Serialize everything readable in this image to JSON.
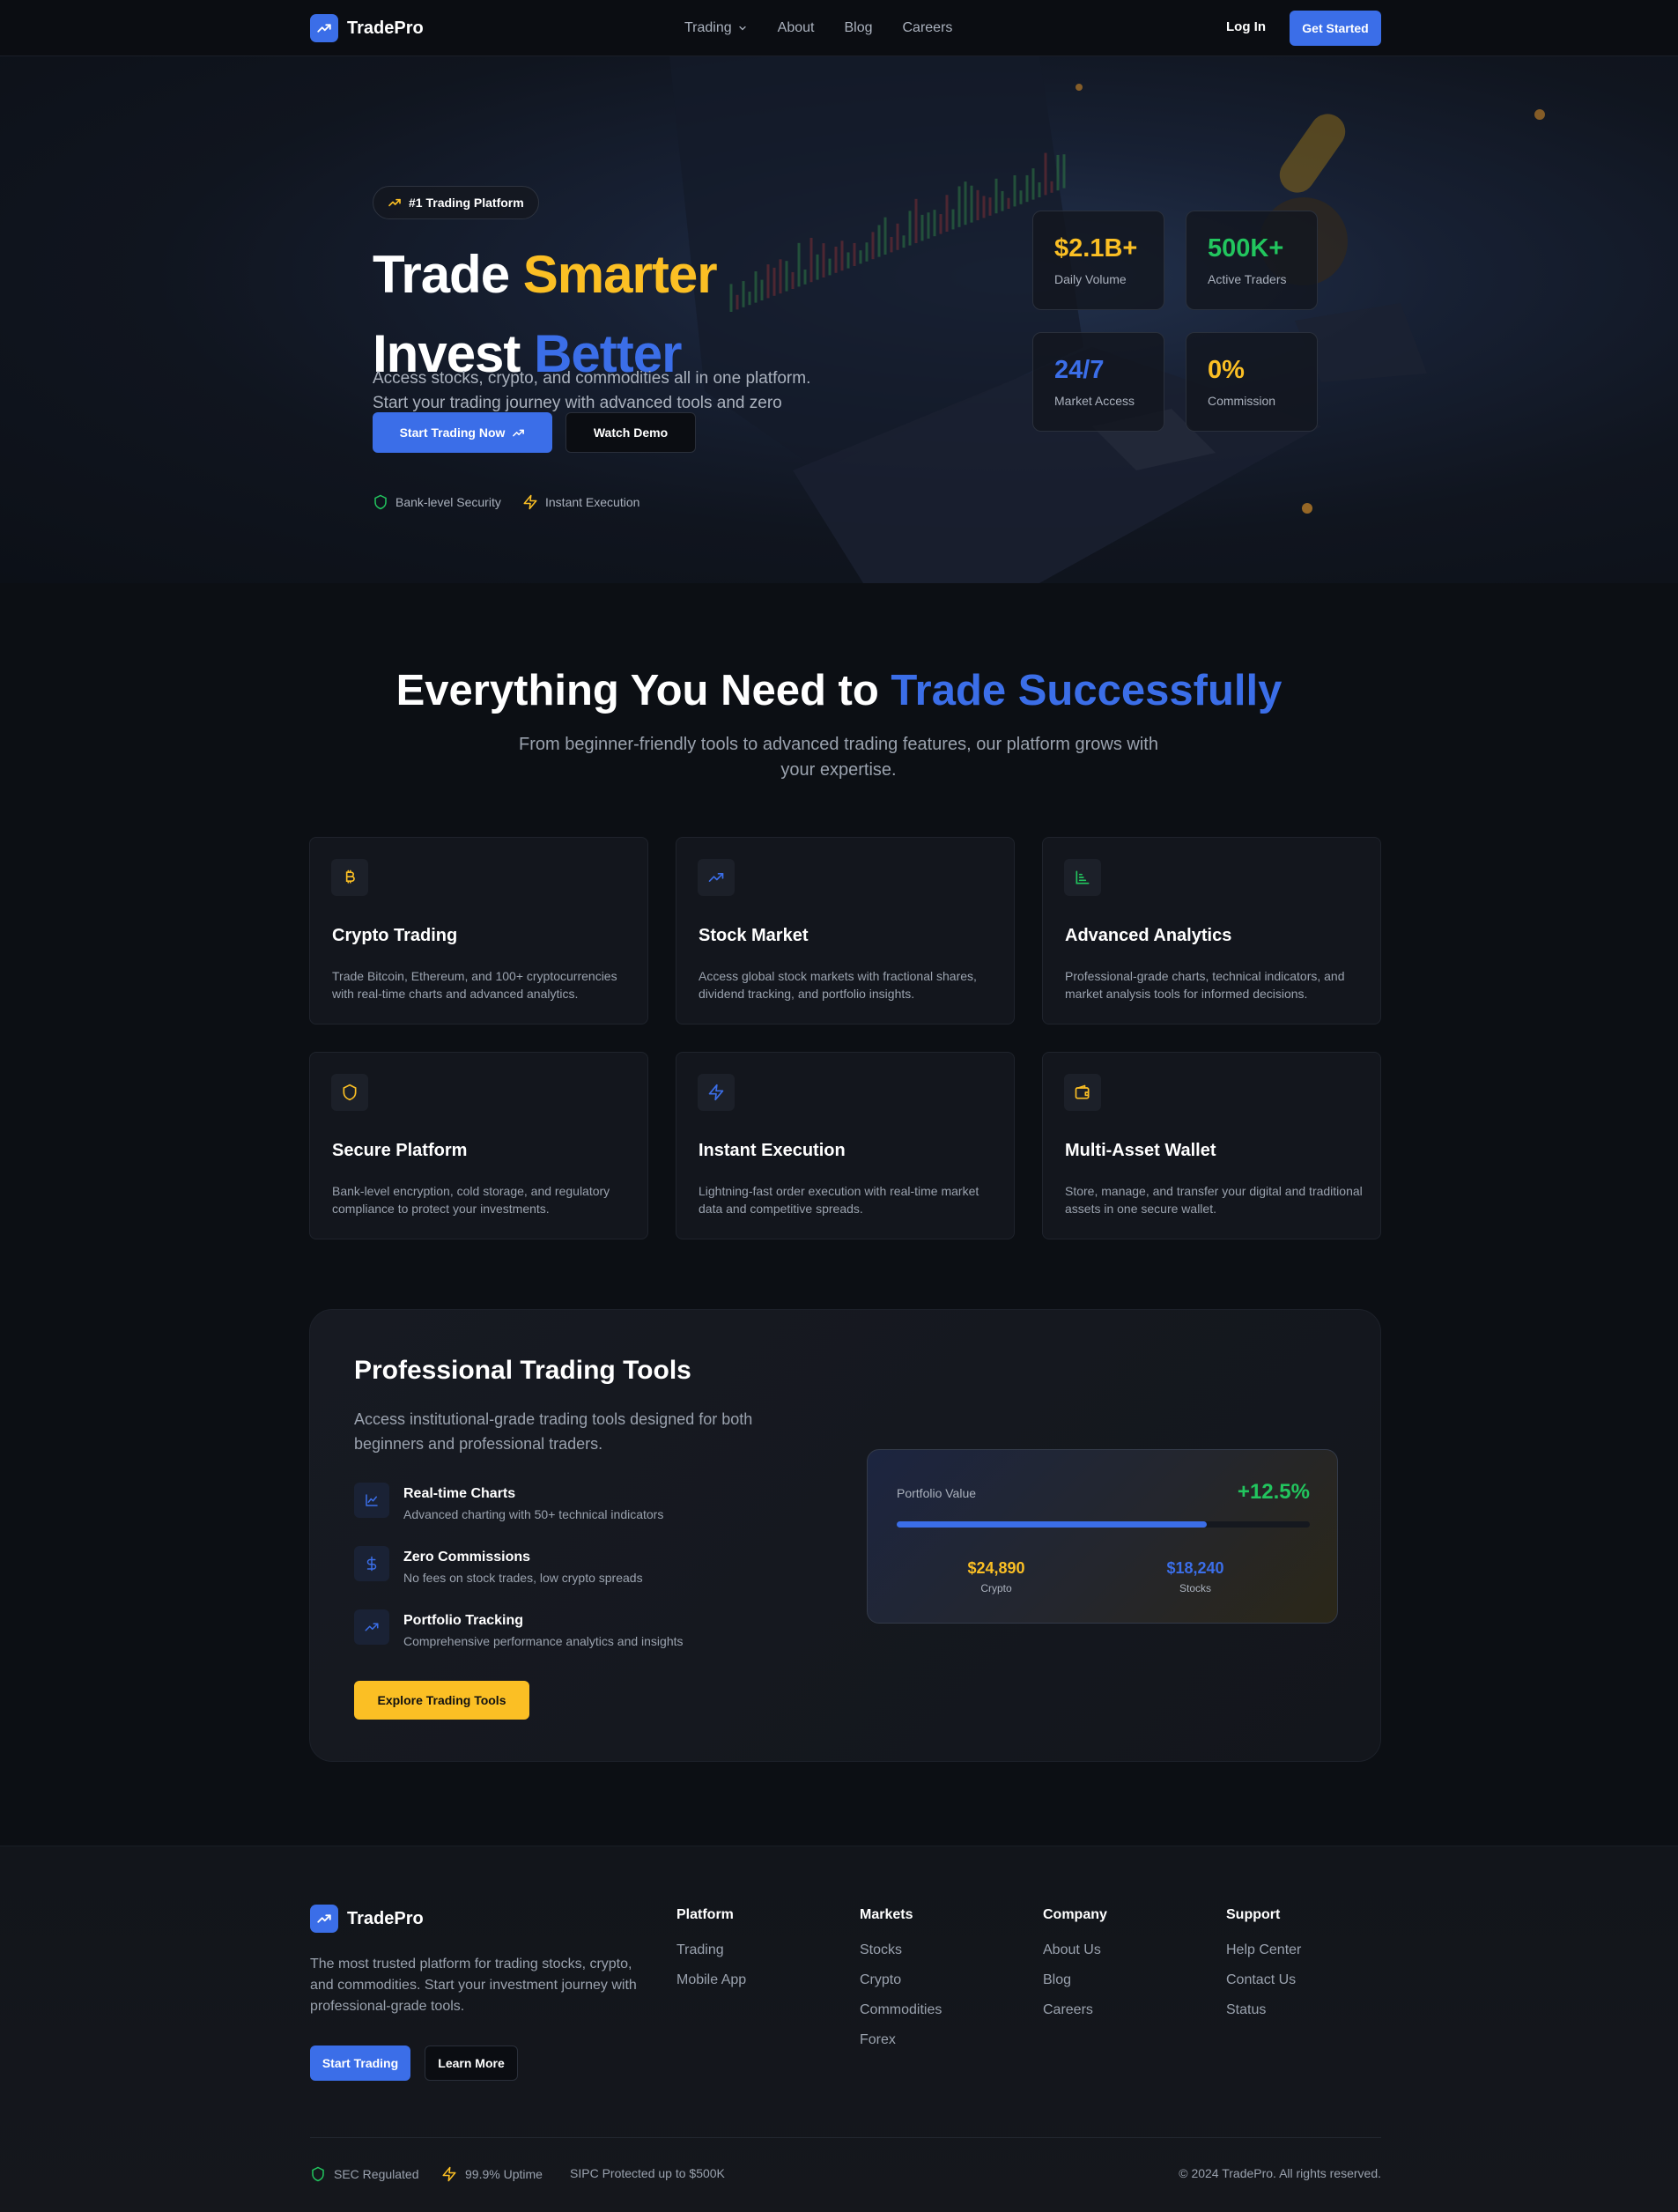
{
  "nav": {
    "brand": "TradePro",
    "links": [
      {
        "label": "Trading",
        "has_dropdown": true
      },
      {
        "label": "About"
      },
      {
        "label": "Blog"
      },
      {
        "label": "Careers"
      }
    ],
    "login": "Log In",
    "cta": "Get Started"
  },
  "hero": {
    "badge": "#1 Trading Platform",
    "title_line1_a": "Trade ",
    "title_line1_b": "Smarter",
    "title_line2_a": "Invest ",
    "title_line2_b": "Better",
    "subtitle": "Access stocks, crypto, and commodities all in one platform. Start your trading journey with advanced tools and zero commissions.",
    "primary_button": "Start Trading Now",
    "secondary_button": "Watch Demo",
    "trust": [
      "Bank-level Security",
      "Instant Execution"
    ],
    "stats": [
      {
        "value": "$2.1B+",
        "label": "Daily Volume",
        "color": "#fbbf24"
      },
      {
        "value": "500K+",
        "label": "Active Traders",
        "color": "#22c55e"
      },
      {
        "value": "24/7",
        "label": "Market Access",
        "color": "#3b6ee8"
      },
      {
        "value": "0%",
        "label": "Commission",
        "color": "#fbbf24"
      }
    ]
  },
  "features": {
    "title_a": "Everything You Need to ",
    "title_b": "Trade Successfully",
    "subtitle": "From beginner-friendly tools to advanced trading features, our platform grows with your expertise.",
    "cards": [
      {
        "icon": "bitcoin-icon",
        "title": "Crypto Trading",
        "desc": "Trade Bitcoin, Ethereum, and 100+ cryptocurrencies with real-time charts and advanced analytics."
      },
      {
        "icon": "trending-up-icon",
        "title": "Stock Market",
        "desc": "Access global stock markets with fractional shares, dividend tracking, and portfolio insights."
      },
      {
        "icon": "bar-chart-icon",
        "title": "Advanced Analytics",
        "desc": "Professional-grade charts, technical indicators, and market analysis tools for informed decisions."
      },
      {
        "icon": "shield-icon",
        "title": "Secure Platform",
        "desc": "Bank-level encryption, cold storage, and regulatory compliance to protect your investments."
      },
      {
        "icon": "lightning-icon",
        "title": "Instant Execution",
        "desc": "Lightning-fast order execution with real-time market data and competitive spreads."
      },
      {
        "icon": "wallet-icon",
        "title": "Multi-Asset Wallet",
        "desc": "Store, manage, and transfer your digital and traditional assets in one secure wallet."
      }
    ]
  },
  "tools": {
    "title": "Professional Trading Tools",
    "subtitle": "Access institutional-grade trading tools designed for both beginners and professional traders.",
    "items": [
      {
        "icon": "line-chart-icon",
        "name": "Real-time Charts",
        "desc": "Advanced charting with 50+ technical indicators"
      },
      {
        "icon": "dollar-icon",
        "name": "Zero Commissions",
        "desc": "No fees on stock trades, low crypto spreads"
      },
      {
        "icon": "trending-up-icon",
        "name": "Portfolio Tracking",
        "desc": "Comprehensive performance analytics and insights"
      }
    ],
    "button": "Explore Trading Tools",
    "portfolio": {
      "label": "Portfolio Value",
      "change": "+12.5%",
      "progress": 0.75,
      "assets": [
        {
          "amount": "$24,890",
          "label": "Crypto",
          "color": "#fbbf24"
        },
        {
          "amount": "$18,240",
          "label": "Stocks",
          "color": "#3b6ee8"
        }
      ]
    }
  },
  "footer": {
    "brand": "TradePro",
    "description": "The most trusted platform for trading stocks, crypto, and commodities. Start your investment journey with professional-grade tools.",
    "primary_button": "Start Trading",
    "secondary_button": "Learn More",
    "columns": [
      {
        "heading": "Platform",
        "links": [
          "Trading",
          "Mobile App"
        ]
      },
      {
        "heading": "Markets",
        "links": [
          "Stocks",
          "Crypto",
          "Commodities",
          "Forex"
        ]
      },
      {
        "heading": "Company",
        "links": [
          "About Us",
          "Blog",
          "Careers"
        ]
      },
      {
        "heading": "Support",
        "links": [
          "Help Center",
          "Contact Us",
          "Status"
        ]
      }
    ],
    "badges": [
      "SEC Regulated",
      "99.9% Uptime",
      "SIPC Protected up to $500K"
    ],
    "copyright": "© 2024 TradePro. All rights reserved."
  },
  "colors": {
    "accent_blue": "#3b6ee8",
    "accent_yellow": "#fbbf24",
    "accent_green": "#22c55e",
    "background": "#0c0f14"
  }
}
